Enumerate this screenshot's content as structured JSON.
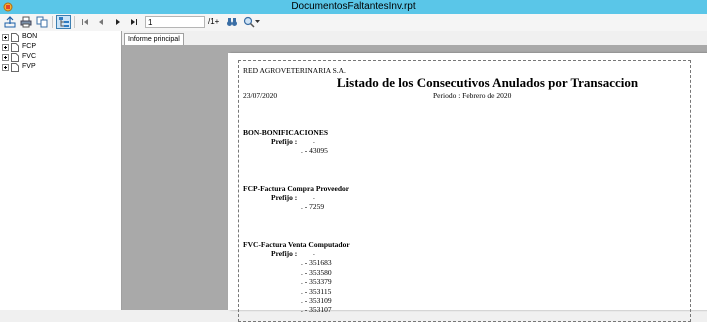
{
  "window": {
    "title": "DocumentosFaltantesInv.rpt"
  },
  "toolbar": {
    "buttons": [
      {
        "name": "export-button",
        "icon": "export-icon"
      },
      {
        "name": "print-button",
        "icon": "printer-icon"
      },
      {
        "name": "copy-button",
        "icon": "copy-icon"
      },
      {
        "name": "toggle-tree-button",
        "icon": "group-tree-icon"
      },
      {
        "name": "first-page-button",
        "icon": "first-page-icon"
      },
      {
        "name": "previous-page-button",
        "icon": "previous-page-icon"
      },
      {
        "name": "next-page-button",
        "icon": "next-page-icon"
      },
      {
        "name": "last-page-button",
        "icon": "last-page-icon"
      },
      {
        "name": "find-button",
        "icon": "binoculars-icon"
      },
      {
        "name": "zoom-button",
        "icon": "zoom-icon"
      }
    ],
    "page_value": "1",
    "page_total": "/1+"
  },
  "tree": {
    "items": [
      {
        "label": "BON"
      },
      {
        "label": "FCP"
      },
      {
        "label": "FVC"
      },
      {
        "label": "FVP"
      }
    ]
  },
  "tabs": [
    {
      "label": "Informe principal"
    }
  ],
  "report": {
    "company": "RED AGROVETERINARIA S.A.",
    "title": "Listado de los Consecutivos Anulados por Transaccion",
    "date": "23/07/2020",
    "period": "Periodo : Febrero de 2020",
    "prefix_label": "Prefijo :",
    "prefix_value": ".",
    "sections": [
      {
        "heading": "BON-BONIFICACIONES",
        "values": [
          ". - 43095"
        ]
      },
      {
        "heading": "FCP-Factura Compra Proveedor",
        "values": [
          ". - 7259"
        ]
      },
      {
        "heading": "FVC-Factura Venta Computador",
        "values": [
          ". - 351683",
          ". - 353580",
          ". - 353379",
          ". - 353115",
          ". - 353109",
          ". - 353107"
        ]
      }
    ]
  },
  "colors": {
    "titlebar": "#5ac6e8",
    "viewer_bg": "#a9a9a9"
  }
}
